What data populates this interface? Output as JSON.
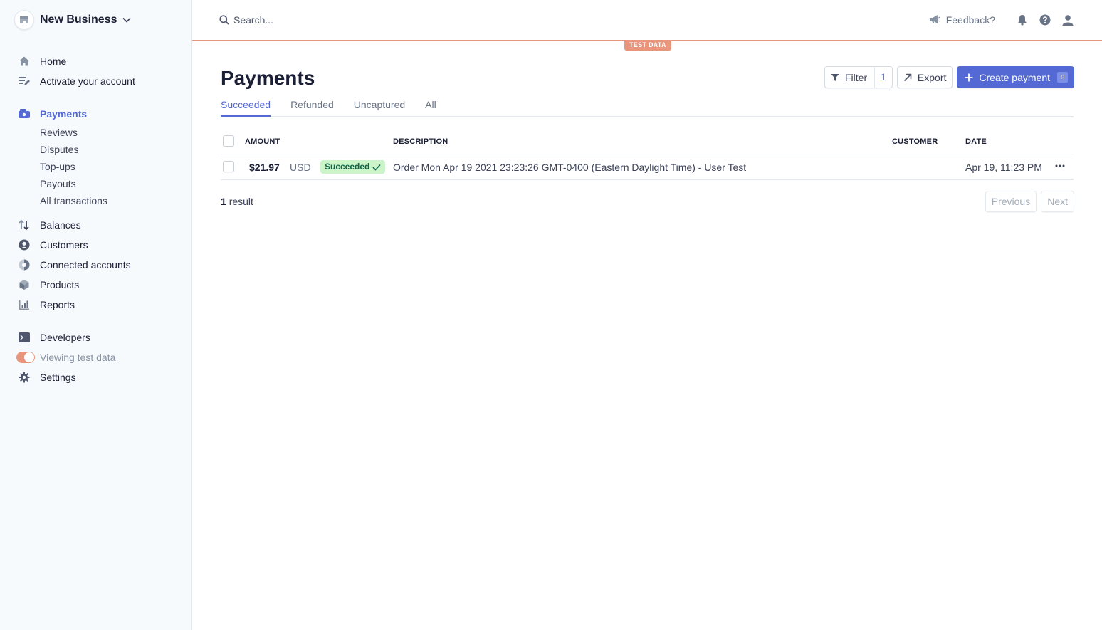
{
  "sidebar": {
    "business_name": "New Business",
    "nav": {
      "home": "Home",
      "activate": "Activate your account",
      "payments": "Payments",
      "reviews": "Reviews",
      "disputes": "Disputes",
      "topups": "Top-ups",
      "payouts": "Payouts",
      "all_transactions": "All transactions",
      "balances": "Balances",
      "customers": "Customers",
      "connected_accounts": "Connected accounts",
      "products": "Products",
      "reports": "Reports",
      "developers": "Developers",
      "viewing_test_data": "Viewing test data",
      "settings": "Settings"
    },
    "test_data_toggle_on": true
  },
  "header": {
    "search_placeholder": "Search...",
    "feedback": "Feedback?",
    "test_badge": "TEST DATA"
  },
  "page": {
    "title": "Payments",
    "actions": {
      "filter": "Filter",
      "filter_count": "1",
      "export": "Export",
      "create": "Create payment",
      "create_shortcut": "n"
    },
    "tabs": [
      "Succeeded",
      "Refunded",
      "Uncaptured",
      "All"
    ],
    "active_tab": "Succeeded",
    "table": {
      "columns": {
        "amount": "AMOUNT",
        "description": "DESCRIPTION",
        "customer": "CUSTOMER",
        "date": "DATE"
      },
      "rows": [
        {
          "amount": "$21.97",
          "currency": "USD",
          "status": "Succeeded",
          "description": "Order Mon Apr 19 2021 23:23:26 GMT-0400 (Eastern Daylight Time) - User Test",
          "customer": "",
          "date": "Apr 19, 11:23 PM"
        }
      ]
    },
    "result_count": "1",
    "result_label": "result",
    "pagination": {
      "previous": "Previous",
      "next": "Next"
    }
  },
  "colors": {
    "accent": "#5469d4",
    "test_mode": "#e8957c",
    "success_bg": "#cbf4c9",
    "success_text": "#0e6245"
  }
}
